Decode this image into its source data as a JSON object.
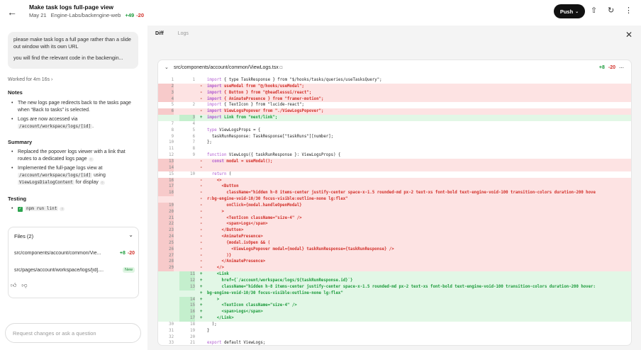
{
  "header": {
    "title": "Make task logs full-page view",
    "date": "May 21",
    "repo": "Engine-Labs/backengine-web",
    "additions": "+49",
    "deletions": "-20",
    "push_label": "Push"
  },
  "chat": {
    "message_line1": "please make task logs a full page rather than a slide out window with its own URL",
    "message_line2": "you will find the relevant code in the backengin...",
    "worked_for": "Worked for 4m 16s",
    "notes_heading": "Notes",
    "notes": [
      {
        "text": "The new logs page redirects back to the tasks page when “Back to tasks” is selected."
      },
      {
        "text_before": "Logs are now accessed via ",
        "code": "/account/workspace/logs/[id]",
        "text_after": "."
      }
    ],
    "summary_heading": "Summary",
    "summary": [
      {
        "text": "Replaced the popover logs viewer with a link that routes to a dedicated logs page"
      },
      {
        "text_before": "Implemented the full-page logs view at ",
        "code": "/account/workspace/logs/[id]",
        "text_mid": " using ",
        "code2": "ViewLogsDialogContent",
        "text_after": " for display"
      }
    ],
    "testing_heading": "Testing",
    "testing_cmd": "npm run lint",
    "files_heading": "Files (2)",
    "files": [
      {
        "name": "src/components/account/common/Vie...",
        "add": "+8",
        "del": "-20"
      },
      {
        "name": "src/pages/account/workspace/logs/[id]....",
        "badge": "New"
      }
    ],
    "composer_placeholder": "Request changes or ask a question"
  },
  "panel": {
    "tab_diff": "Diff",
    "tab_logs": "Logs",
    "file_path": "src/components/account/common/ViewLogs.tsx",
    "add": "+8",
    "del": "-20"
  },
  "diff_lines": [
    {
      "t": "ctx",
      "o": "1",
      "n": "1",
      "c": "import { type TaskResponse } from \"$/hooks/tasks/queries/useTasksQuery\";"
    },
    {
      "t": "del",
      "o": "2",
      "n": "",
      "c": "import useModal from \"@/hooks/useModal\";"
    },
    {
      "t": "del",
      "o": "3",
      "n": "",
      "c": "import { Button } from \"@headlessui/react\";"
    },
    {
      "t": "del",
      "o": "4",
      "n": "",
      "c": "import { AnimatePresence } from \"framer-motion\";"
    },
    {
      "t": "ctx",
      "o": "5",
      "n": "2",
      "c": "import { TextIcon } from \"lucide-react\";"
    },
    {
      "t": "del",
      "o": "6",
      "n": "",
      "c": "import ViewLogsPopover from \"./ViewLogsPopover\";"
    },
    {
      "t": "add",
      "o": "",
      "n": "3",
      "c": "import Link from \"next/link\";"
    },
    {
      "t": "ctx",
      "o": "7",
      "n": "4",
      "c": ""
    },
    {
      "t": "ctx",
      "o": "8",
      "n": "5",
      "c": "type ViewLogsProps = {"
    },
    {
      "t": "ctx",
      "o": "9",
      "n": "6",
      "c": "  taskRunResponse: TaskResponse[\"taskRuns\"][number];"
    },
    {
      "t": "ctx",
      "o": "10",
      "n": "7",
      "c": "};"
    },
    {
      "t": "ctx",
      "o": "11",
      "n": "8",
      "c": ""
    },
    {
      "t": "ctx",
      "o": "12",
      "n": "9",
      "c": "function ViewLogs({ taskRunResponse }: ViewLogsProps) {"
    },
    {
      "t": "del",
      "o": "13",
      "n": "",
      "c": "  const modal = useModal();"
    },
    {
      "t": "del",
      "o": "14",
      "n": "",
      "c": ""
    },
    {
      "t": "ctx",
      "o": "15",
      "n": "10",
      "c": "  return ("
    },
    {
      "t": "del",
      "o": "16",
      "n": "",
      "c": "    <>"
    },
    {
      "t": "del",
      "o": "17",
      "n": "",
      "c": "      <Button"
    },
    {
      "t": "del",
      "o": "18",
      "n": "",
      "c": "        className=\"hidden h-8 items-center justify-center space-x-1.5 rounded-md px-2 text-xs font-bold text-engine-void-100 transition-colors duration-200 hove"
    },
    {
      "t": "del",
      "o": "",
      "n": "",
      "c": "r:bg-engine-void-10/30 focus-visible:outline-none lg:flex\""
    },
    {
      "t": "del",
      "o": "19",
      "n": "",
      "c": "        onClick={modal.handleOpenModal}"
    },
    {
      "t": "del",
      "o": "20",
      "n": "",
      "c": "      >"
    },
    {
      "t": "del",
      "o": "21",
      "n": "",
      "c": "        <TextIcon className=\"size-4\" />"
    },
    {
      "t": "del",
      "o": "22",
      "n": "",
      "c": "        <span>Logs</span>"
    },
    {
      "t": "del",
      "o": "23",
      "n": "",
      "c": "      </Button>"
    },
    {
      "t": "del",
      "o": "24",
      "n": "",
      "c": "      <AnimatePresence>"
    },
    {
      "t": "del",
      "o": "25",
      "n": "",
      "c": "        {modal.isOpen && ("
    },
    {
      "t": "del",
      "o": "26",
      "n": "",
      "c": "          <ViewLogsPopover modal={modal} taskRunResponse={taskRunResponse} />"
    },
    {
      "t": "del",
      "o": "27",
      "n": "",
      "c": "        )}"
    },
    {
      "t": "del",
      "o": "28",
      "n": "",
      "c": "      </AnimatePresence>"
    },
    {
      "t": "del",
      "o": "29",
      "n": "",
      "c": "    </>"
    },
    {
      "t": "add",
      "o": "",
      "n": "11",
      "c": "    <Link"
    },
    {
      "t": "add",
      "o": "",
      "n": "12",
      "c": "      href={`/account/workspace/logs/${taskRunResponse.id}`}"
    },
    {
      "t": "add",
      "o": "",
      "n": "13",
      "c": "      className=\"hidden h-8 items-center justify-center space-x-1.5 rounded-md px-2 text-xs font-bold text-engine-void-100 transition-colors duration-200 hover:"
    },
    {
      "t": "add",
      "o": "",
      "n": "",
      "c": "bg-engine-void-10/30 focus-visible:outline-none lg:flex\""
    },
    {
      "t": "add",
      "o": "",
      "n": "14",
      "c": "    >"
    },
    {
      "t": "add",
      "o": "",
      "n": "15",
      "c": "      <TextIcon className=\"size-4\" />"
    },
    {
      "t": "add",
      "o": "",
      "n": "16",
      "c": "      <span>Logs</span>"
    },
    {
      "t": "add",
      "o": "",
      "n": "17",
      "c": "    </Link>"
    },
    {
      "t": "ctx",
      "o": "30",
      "n": "18",
      "c": "  );"
    },
    {
      "t": "ctx",
      "o": "31",
      "n": "19",
      "c": "}"
    },
    {
      "t": "ctx",
      "o": "32",
      "n": "20",
      "c": ""
    },
    {
      "t": "ctx",
      "o": "33",
      "n": "21",
      "c": "export default ViewLogs;"
    }
  ]
}
